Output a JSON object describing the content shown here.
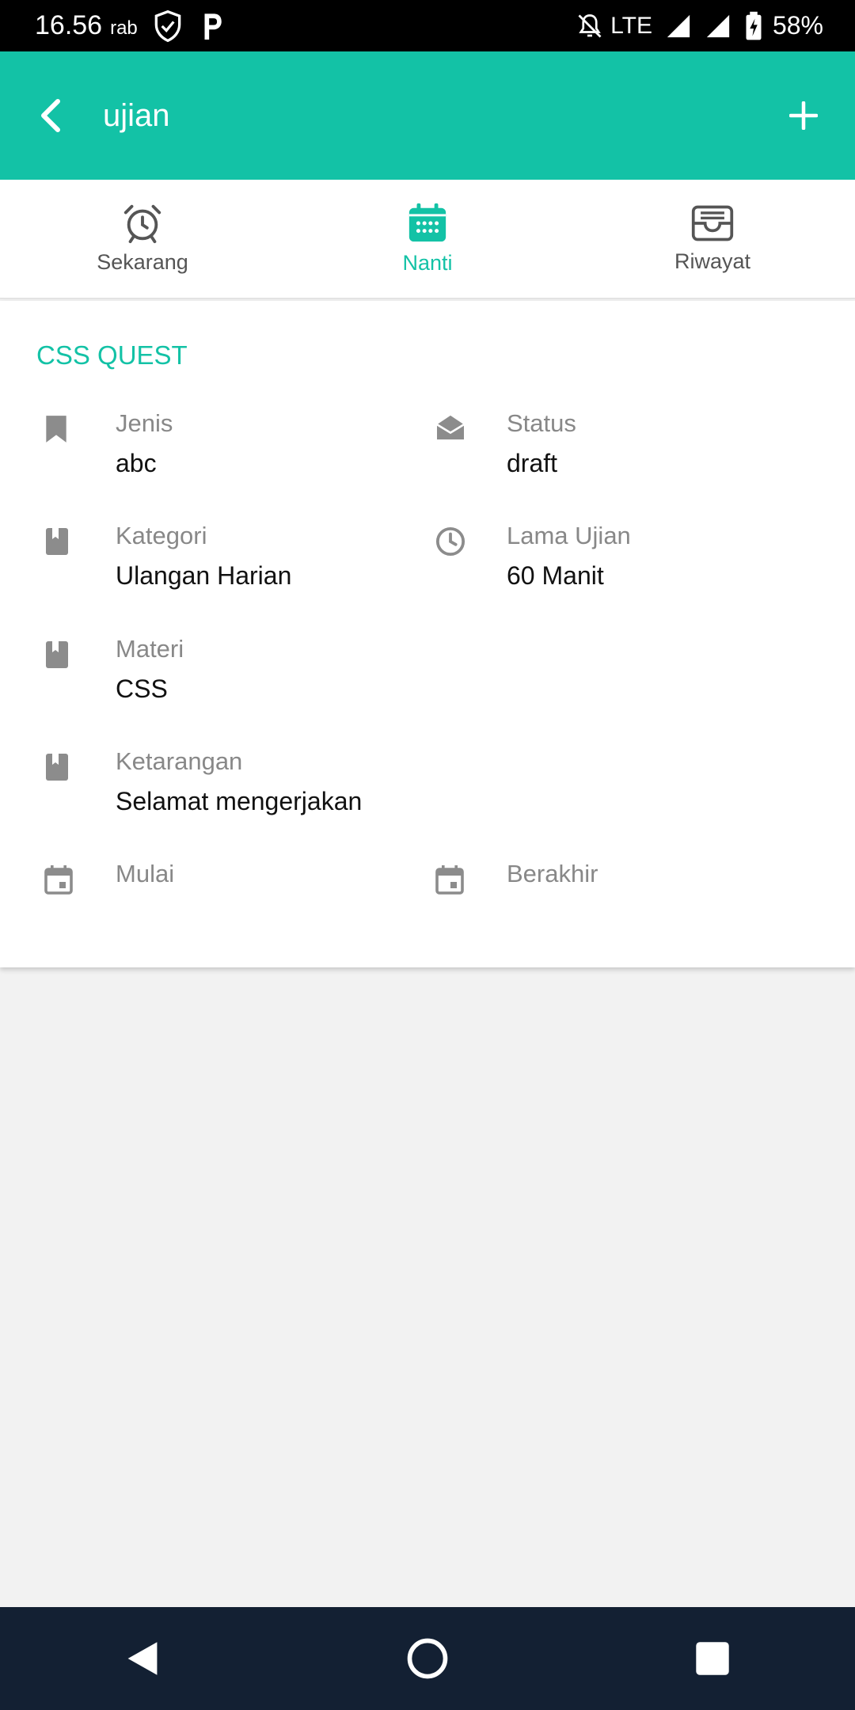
{
  "status_bar": {
    "time": "16.56",
    "day": "rab",
    "network": "LTE",
    "battery": "58%"
  },
  "app_bar": {
    "title": "ujian"
  },
  "tabs": [
    {
      "label": "Sekarang",
      "icon": "alarm-clock-icon",
      "active": false
    },
    {
      "label": "Nanti",
      "icon": "calendar-icon",
      "active": true
    },
    {
      "label": "Riwayat",
      "icon": "inbox-tray-icon",
      "active": false
    }
  ],
  "exam": {
    "title": "CSS QUEST",
    "fields": {
      "jenis": {
        "label": "Jenis",
        "value": "abc",
        "icon": "bookmark-icon"
      },
      "status": {
        "label": "Status",
        "value": "draft",
        "icon": "envelope-open-icon"
      },
      "kategori": {
        "label": "Kategori",
        "value": "Ulangan Harian",
        "icon": "book-icon"
      },
      "lama": {
        "label": "Lama Ujian",
        "value": "60 Manit",
        "icon": "clock-icon"
      },
      "materi": {
        "label": "Materi",
        "value": "CSS",
        "icon": "book-icon"
      },
      "keterangan": {
        "label": "Ketarangan",
        "value": "Selamat mengerjakan",
        "icon": "book-icon"
      },
      "mulai": {
        "label": "Mulai",
        "value": "",
        "icon": "calendar-icon"
      },
      "berakhir": {
        "label": "Berakhir",
        "value": "",
        "icon": "calendar-icon"
      }
    }
  },
  "colors": {
    "accent": "#13c2a6",
    "navbar": "#132033"
  }
}
